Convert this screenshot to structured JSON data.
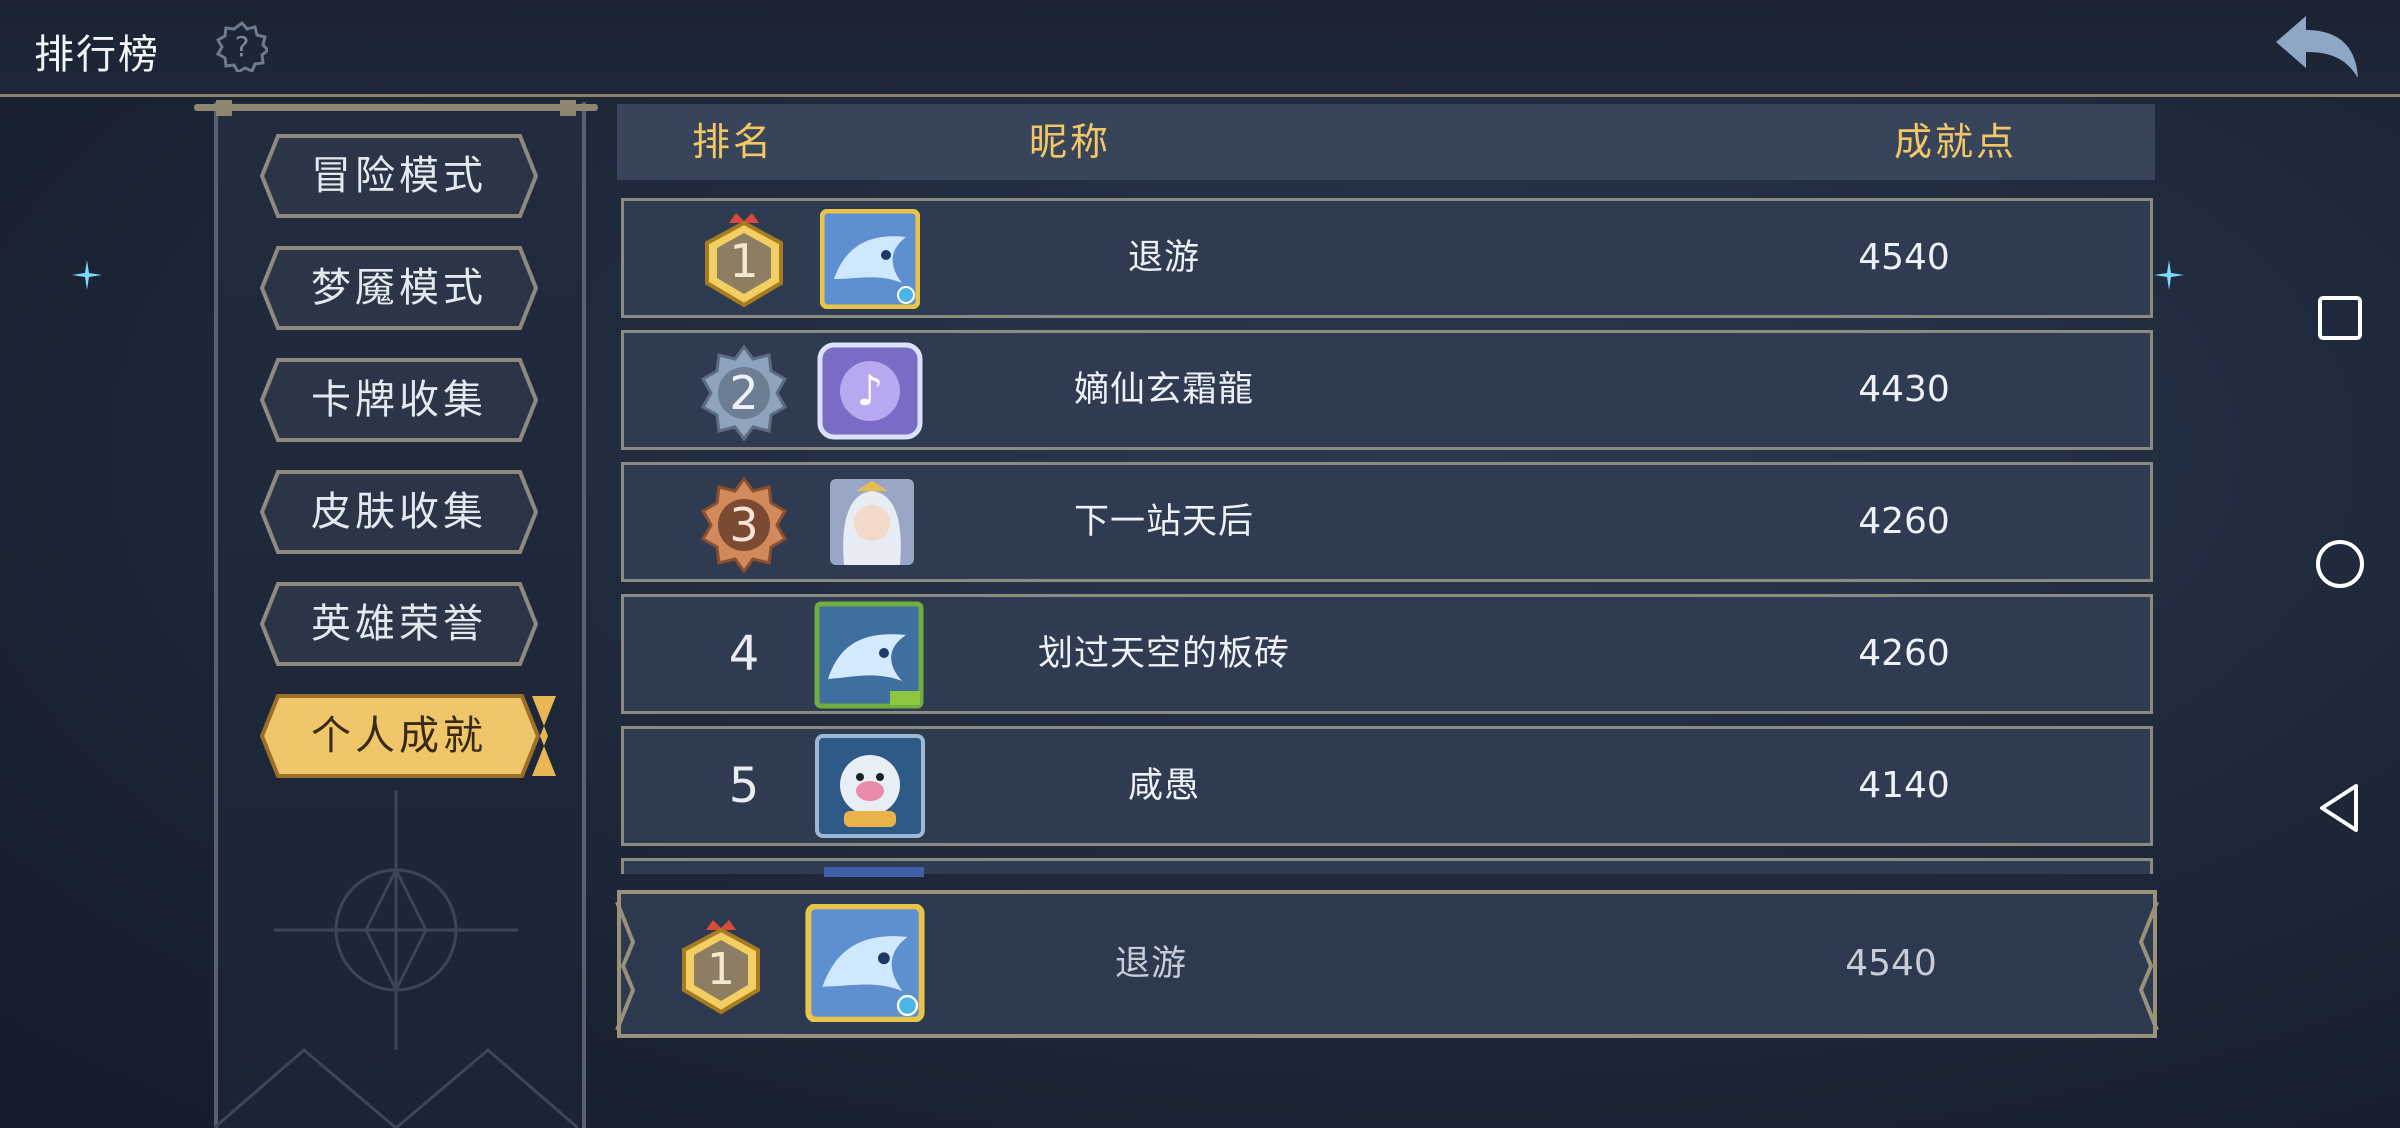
{
  "header": {
    "title": "排行榜",
    "help_icon": "help-icon",
    "back_icon": "back-arrow-icon"
  },
  "sidebar": {
    "items": [
      {
        "label": "冒险模式",
        "active": false
      },
      {
        "label": "梦魇模式",
        "active": false
      },
      {
        "label": "卡牌收集",
        "active": false
      },
      {
        "label": "皮肤收集",
        "active": false
      },
      {
        "label": "英雄荣誉",
        "active": false
      },
      {
        "label": "个人成就",
        "active": true
      }
    ]
  },
  "table": {
    "columns": {
      "rank": "排名",
      "nickname": "昵称",
      "points": "成就点"
    },
    "rows": [
      {
        "rank": "1",
        "nickname": "退游",
        "points": "4540",
        "badge": "gold"
      },
      {
        "rank": "2",
        "nickname": "嫡仙玄霜龍",
        "points": "4430",
        "badge": "silver"
      },
      {
        "rank": "3",
        "nickname": "下一站天后",
        "points": "4260",
        "badge": "bronze"
      },
      {
        "rank": "4",
        "nickname": "划过天空的板砖",
        "points": "4260",
        "badge": ""
      },
      {
        "rank": "5",
        "nickname": "咸愚",
        "points": "4140",
        "badge": ""
      }
    ]
  },
  "self": {
    "rank": "1",
    "nickname": "退游",
    "points": "4540"
  },
  "colors": {
    "accent_gold": "#f3c766",
    "header_bg": "#374459",
    "row_bg": "#2f3b50",
    "border": "#8b8a7e"
  },
  "navbar": {
    "icons": [
      "recent-apps-icon",
      "home-icon",
      "back-icon"
    ]
  }
}
